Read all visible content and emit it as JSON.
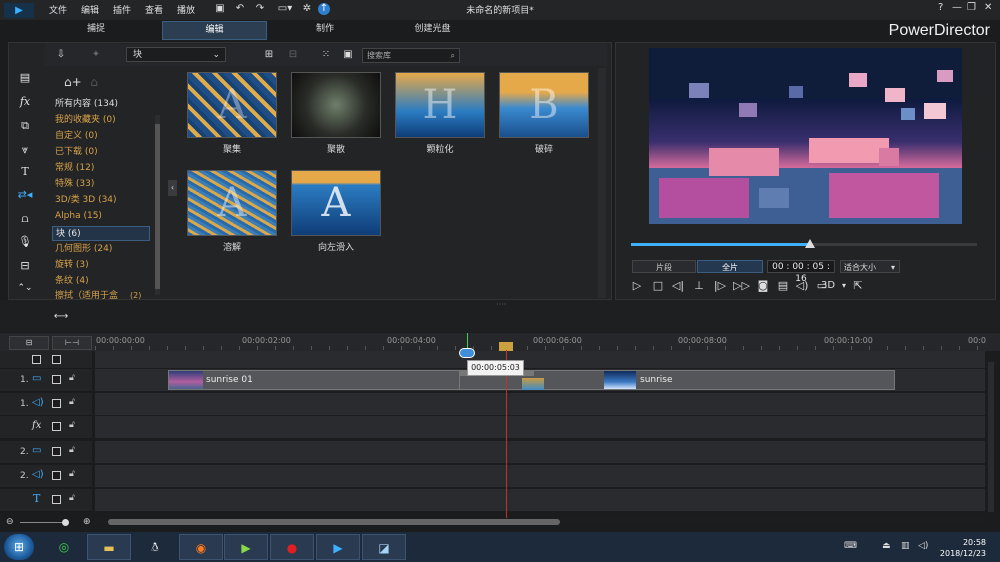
{
  "app": {
    "title": "未命名的新项目*",
    "brand": "PowerDirector",
    "menu": [
      "文件",
      "编辑",
      "插件",
      "查看",
      "播放"
    ],
    "window_controls": [
      "?",
      "—",
      "❐",
      "✕"
    ]
  },
  "tabs": [
    {
      "label": "捕捉",
      "active": false
    },
    {
      "label": "编辑",
      "active": true
    },
    {
      "label": "制作",
      "active": false
    },
    {
      "label": "创建光盘",
      "active": false
    }
  ],
  "library": {
    "dropdown_value": "块",
    "search_placeholder": "搜索库",
    "categories": [
      {
        "label": "所有内容 (134)",
        "selected": false
      },
      {
        "label": "我的收藏夹  (0)",
        "selected": false
      },
      {
        "label": "自定义  (0)",
        "selected": false
      },
      {
        "label": "已下载  (0)",
        "selected": false
      },
      {
        "label": "常规  (12)",
        "selected": false
      },
      {
        "label": "特殊  (33)",
        "selected": false
      },
      {
        "label": "3D/类 3D  (34)",
        "selected": false
      },
      {
        "label": "Alpha  (15)",
        "selected": false
      },
      {
        "label": "块  (6)",
        "selected": true
      },
      {
        "label": "几何图形  (24)",
        "selected": false
      },
      {
        "label": "旋转  (3)",
        "selected": false
      },
      {
        "label": "条纹  (4)",
        "selected": false
      },
      {
        "label": "擦拭（适用于盒",
        "selected": false
      }
    ],
    "category_extra": "(2)",
    "transitions": [
      {
        "label": "聚集",
        "glyph": "A"
      },
      {
        "label": "聚散",
        "glyph": ""
      },
      {
        "label": "颗粒化",
        "glyph": "H"
      },
      {
        "label": "破碎",
        "glyph": "B"
      },
      {
        "label": "溶解",
        "glyph": "A"
      },
      {
        "label": "向左滑入",
        "glyph": "A"
      }
    ]
  },
  "preview": {
    "segment_button": "片段",
    "full_button": "全片",
    "timecode": "00 : 00 : 05 : 16",
    "fit_select": "适合大小",
    "mode_3d": "3D",
    "progress": 0.515
  },
  "timeline": {
    "ruler_labels": [
      "00:00:00:00",
      "00:00:02:00",
      "00:00:04:00",
      "00:00:06:00",
      "00:00:08:00",
      "00:00:10:00",
      "00:0"
    ],
    "tooltip": "00:00:05:03",
    "tracks": [
      {
        "label": "1.",
        "type": "video"
      },
      {
        "label": "1.",
        "type": "audio"
      },
      {
        "label": "",
        "type": "fx"
      },
      {
        "label": "2.",
        "type": "video"
      },
      {
        "label": "2.",
        "type": "audio"
      },
      {
        "label": "",
        "type": "text"
      }
    ],
    "clip1_name": "sunrise 01",
    "clip2_name": "sunrise"
  },
  "taskbar": {
    "time": "20:58",
    "date": "2018/12/23"
  },
  "colors": {
    "accent": "#3fb0ff",
    "category": "#d7a24a",
    "playhead": "#c0322e"
  }
}
